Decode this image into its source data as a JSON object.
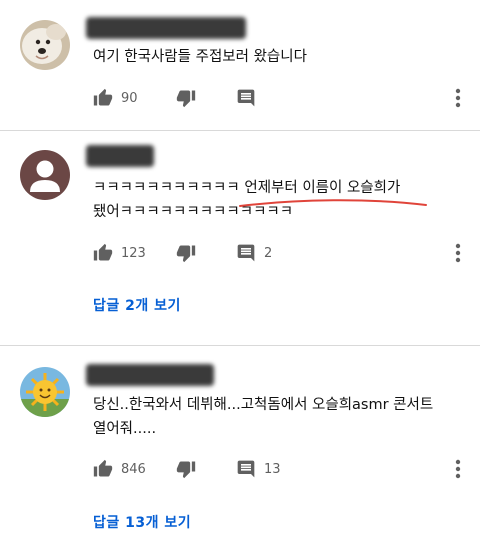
{
  "comments": [
    {
      "author": "",
      "text": "여기 한국사람들 주접보러 왔습니다",
      "likes": "90",
      "reply_count": "",
      "replies_label": ""
    },
    {
      "author": "",
      "text": "ㅋㅋㅋㅋㅋㅋㅋㅋㅋㅋㅋ 언제부터 이름이 오슬희가 됐어ㅋㅋㅋㅋㅋㅋㅋㅋㅋㅋㅋㅋㅋ",
      "likes": "123",
      "reply_count": "2",
      "replies_label": "답글 2개 보기"
    },
    {
      "author": "",
      "text": "당신..한국와서 데뷔해...고척돔에서 오슬희asmr 콘서트 열어줘.....",
      "likes": "846",
      "reply_count": "13",
      "replies_label": "답글 13개 보기"
    }
  ],
  "colors": {
    "link": "#065fd4",
    "icon": "#606060",
    "underline": "#e0443a"
  },
  "icons": [
    "like-icon",
    "dislike-icon",
    "reply-icon",
    "more-options-icon"
  ]
}
